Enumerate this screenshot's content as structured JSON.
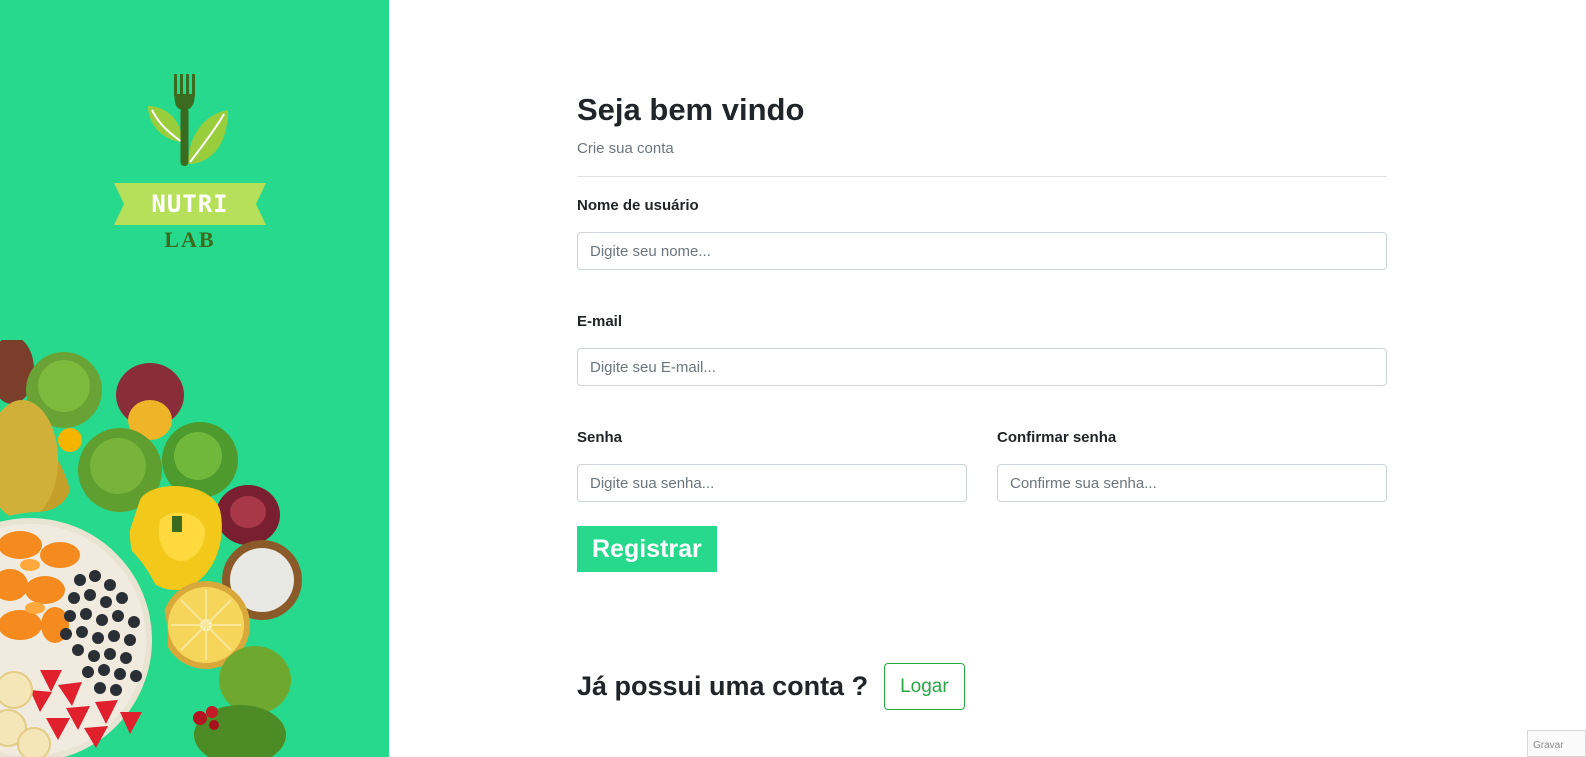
{
  "brand": {
    "name_top": "NUTRI",
    "name_bottom": "LAB",
    "colors": {
      "accent": "#27d98c",
      "leaf": "#9acd3c",
      "leaf_dark": "#3a6b1f"
    }
  },
  "form": {
    "title": "Seja bem vindo",
    "subtitle": "Crie sua conta",
    "username": {
      "label": "Nome de usuário",
      "placeholder": "Digite seu nome...",
      "value": ""
    },
    "email": {
      "label": "E-mail",
      "placeholder": "Digite seu E-mail...",
      "value": ""
    },
    "password": {
      "label": "Senha",
      "placeholder": "Digite sua senha...",
      "value": ""
    },
    "confirm_password": {
      "label": "Confirmar senha",
      "placeholder": "Confirme sua senha...",
      "value": ""
    },
    "submit_label": "Registrar"
  },
  "login": {
    "question": "Já possui uma conta ?",
    "button_label": "Logar",
    "button_color": "#28a745"
  },
  "corner_badge": "Gravar"
}
